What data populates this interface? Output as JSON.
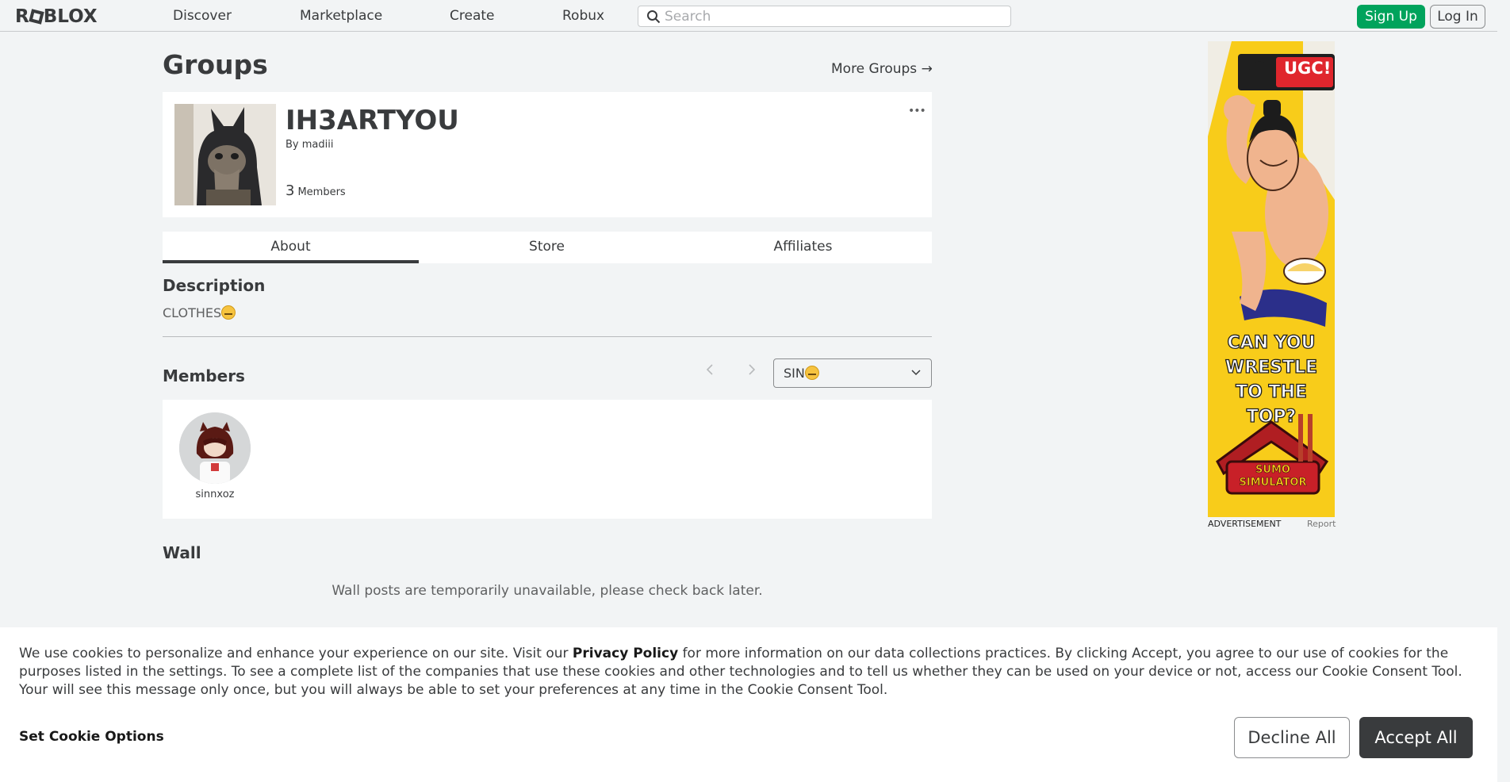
{
  "nav": {
    "logo": "ROBLOX",
    "links": [
      "Discover",
      "Marketplace",
      "Create",
      "Robux"
    ],
    "search_placeholder": "Search",
    "signup_label": "Sign Up",
    "login_label": "Log In"
  },
  "page": {
    "title": "Groups",
    "more_groups": "More Groups →"
  },
  "group": {
    "name": "IH3ARTYOU",
    "by_prefix": "By",
    "owner": "madiii",
    "member_count": "3",
    "members_label": "Members",
    "more_menu": "•••"
  },
  "tabs": [
    "About",
    "Store",
    "Affiliates"
  ],
  "description": {
    "title": "Description",
    "text": "CLOTHES"
  },
  "members": {
    "title": "Members",
    "role_selected": "SIN",
    "list": [
      {
        "name": "sinnxoz"
      }
    ]
  },
  "wall": {
    "title": "Wall",
    "message": "Wall posts are temporarily unavailable, please check back later."
  },
  "ad": {
    "label": "ADVERTISEMENT",
    "report": "Report",
    "badge": "UGC!",
    "headline": "CAN YOU WRESTLE TO THE TOP?",
    "game": "SUMO SIMULATOR"
  },
  "cookie": {
    "text_before": "We use cookies to personalize and enhance your experience on our site. Visit our ",
    "policy": "Privacy Policy",
    "text_after": " for more information on our data collections practices. By clicking Accept, you agree to our use of cookies for the purposes listed in the settings. To see a complete list of the companies that use these cookies and other technologies and to tell us whether they can be used on your device or not, access our Cookie Consent Tool. Your will see this message only once, but you will always be able to set your preferences at any time in the Cookie Consent Tool.",
    "set_options": "Set Cookie Options",
    "decline": "Decline All",
    "accept": "Accept All"
  },
  "colors": {
    "signup_bg": "#00a35c",
    "accept_bg": "#393b3d",
    "page_bg": "#f2f4f5",
    "ad_bg": "#f8cc1a"
  }
}
